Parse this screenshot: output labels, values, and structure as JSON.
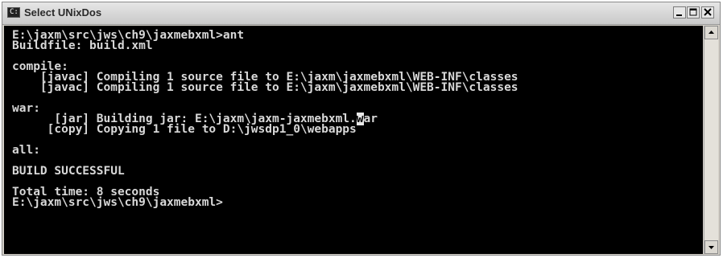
{
  "window": {
    "title": "Select UNixDos",
    "controls": {
      "minimize": "_",
      "maximize": "□",
      "close": "×"
    }
  },
  "console": {
    "lines": [
      "E:\\jaxm\\src\\jws\\ch9\\jaxmebxml>ant",
      "Buildfile: build.xml",
      "",
      "compile:",
      "    [javac] Compiling 1 source file to E:\\jaxm\\jaxmebxml\\WEB-INF\\classes",
      "    [javac] Compiling 1 source file to E:\\jaxm\\jaxmebxml\\WEB-INF\\classes",
      "",
      "war:",
      "      [jar] Building jar: E:\\jaxm\\jaxm-jaxmebxml.",
      "     [copy] Copying 1 file to D:\\jwsdp1_0\\webapps",
      "",
      "all:",
      "",
      "BUILD SUCCESSFUL",
      "",
      "Total time: 8 seconds",
      "E:\\jaxm\\src\\jws\\ch9\\jaxmebxml>"
    ],
    "cursor_char": "w",
    "cursor_tail": "ar"
  },
  "icons": {
    "system": "console-icon",
    "scroll_up": "arrow-up-icon",
    "scroll_down": "arrow-down-icon"
  }
}
